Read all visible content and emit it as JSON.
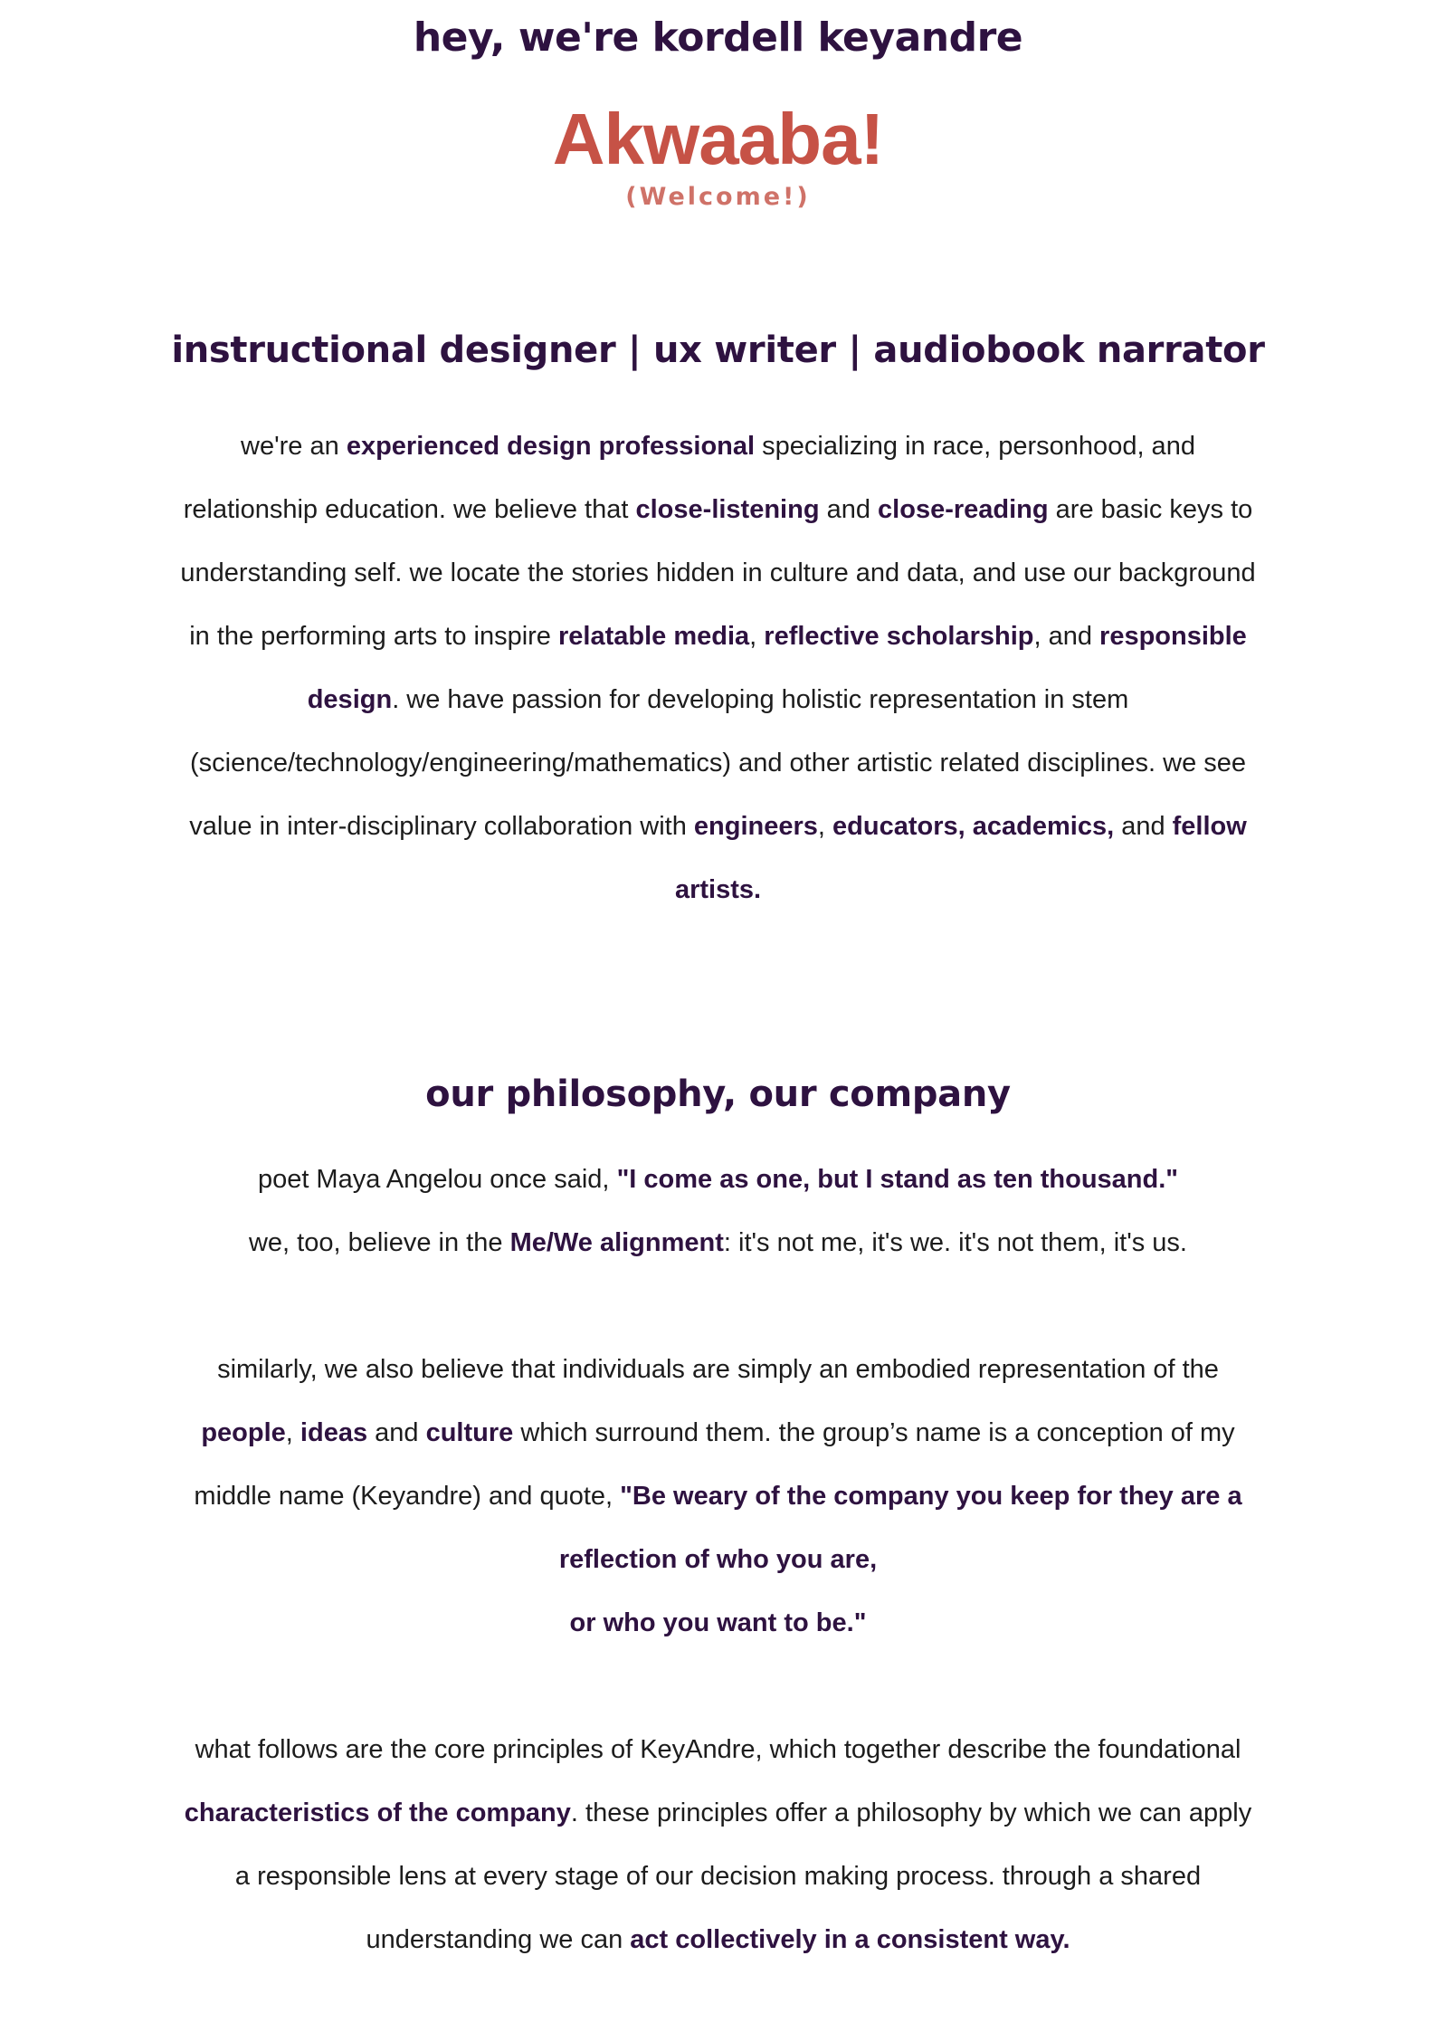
{
  "header": {
    "greeting": "hey, we're kordell keyandre",
    "welcome_title": "Akwaaba!",
    "welcome_subtitle": "(Welcome!)"
  },
  "roles_section": {
    "heading": "instructional designer | ux writer | audiobook narrator",
    "intro": {
      "t1": "we're an ",
      "b1": "experienced design professional",
      "t2": " specializing in race, personhood, and relationship education. we believe that ",
      "b2": "close-listening",
      "t3": " and ",
      "b3": "close-reading",
      "t4": " are basic keys to understanding self. we locate the stories hidden in culture and data, and use our background in the performing arts to inspire ",
      "b4": "relatable media",
      "t5": ", ",
      "b5": "reflective scholarship",
      "t6": ", and ",
      "b6": "responsible design",
      "t7": ". we have passion for developing holistic representation in stem (science/technology/engineering/mathematics) and other artistic related disciplines. we see value in inter-disciplinary collaboration with ",
      "b7": "engineers",
      "t8": ", ",
      "b8": "educators, academics,",
      "t9": " and ",
      "b9": "fellow artists."
    }
  },
  "philosophy_section": {
    "heading": "our philosophy, our company",
    "p1": {
      "t1": "poet Maya Angelou once said, ",
      "b1": "\"I come as one, but I stand as ten thousand.\"",
      "t2": "we, too, believe in the ",
      "b2": "Me/We alignment",
      "t3": ": it's not me, it's we. it's not them, it's us."
    },
    "p2": {
      "t1": "similarly, we also believe that individuals are simply an embodied representation of the ",
      "b1": "people",
      "t2": ", ",
      "b2": "ideas",
      "t3": " and ",
      "b3": "culture",
      "t4": " which surround them. the group’s name is a conception of my middle name (Keyandre) and quote, ",
      "b4": "\"Be weary of the company you keep for they are a reflection of who you are,",
      "b5": "or who you want to be.\""
    },
    "p3": {
      "t1": "what follows are the core principles of KeyAndre, which together describe the foundational ",
      "b1": "characteristics of the company",
      "t2": ". these principles offer a philosophy by which we can apply a responsible lens at every stage of our decision making process. through a shared understanding we can ",
      "b2": "act collectively in a consistent way."
    }
  }
}
